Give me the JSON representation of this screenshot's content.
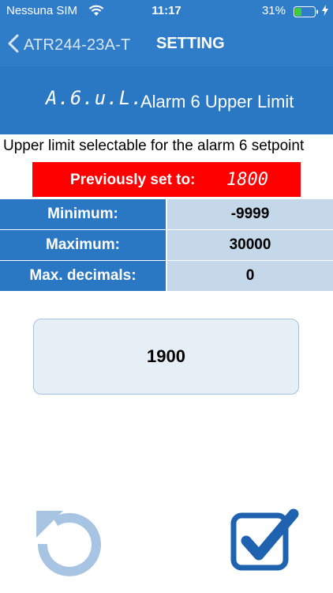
{
  "status_bar": {
    "carrier": "Nessuna SIM",
    "time": "11:17",
    "battery_percent": "31%",
    "icons": [
      "wifi-icon",
      "battery-icon",
      "charging-icon"
    ]
  },
  "nav": {
    "back_label": "ATR244-23A-T",
    "title": "SETTING"
  },
  "parameter": {
    "code": "A.6.u.L.",
    "name": "Alarm 6 Upper Limit",
    "description": "Upper limit selectable for the alarm 6 setpoint"
  },
  "previous": {
    "label": "Previously set to:",
    "value": "1800"
  },
  "limits": [
    {
      "label": "Minimum:",
      "value": "-9999"
    },
    {
      "label": "Maximum:",
      "value": "30000"
    },
    {
      "label": "Max. decimals:",
      "value": "0"
    }
  ],
  "input": {
    "value": "1900"
  },
  "actions": {
    "reset_icon": "undo-icon",
    "confirm_icon": "checkbox-check-icon"
  },
  "colors": {
    "header_blue": "#2a78c4",
    "value_cell": "#c4d8ea",
    "previous_bg": "#ff0000",
    "icon_light_blue": "#a7c4e2",
    "icon_dark_blue": "#1f63b0"
  }
}
